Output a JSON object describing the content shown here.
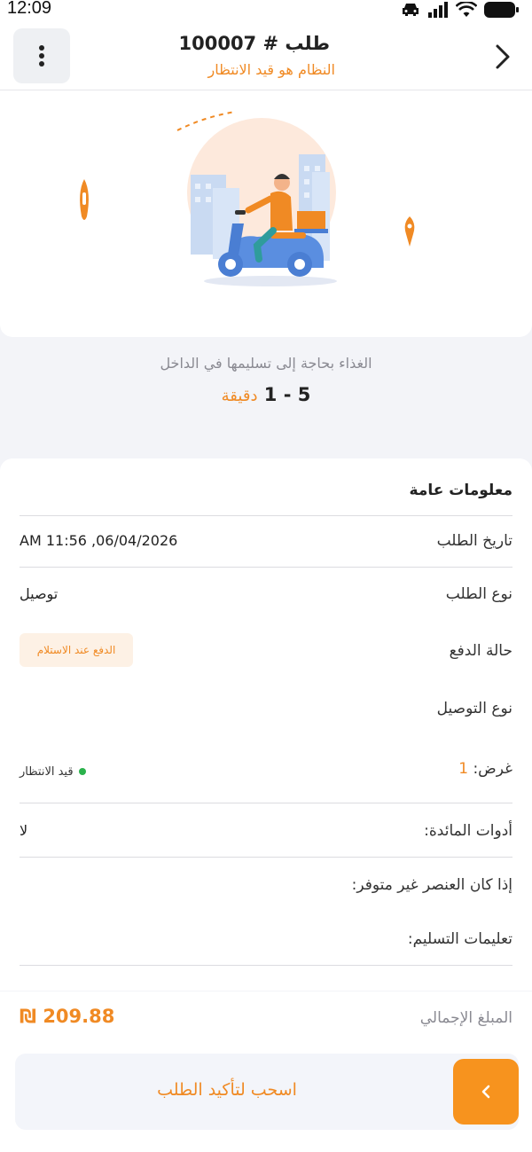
{
  "status_bar": {
    "time": "12:09"
  },
  "header": {
    "order_word": "طلب",
    "order_hash": "#",
    "order_number": "100007",
    "subtitle": "النظام هو قيد الانتظار"
  },
  "eta": {
    "text": "الغذاء بحاجة إلى تسليمها في الداخل",
    "range": "1 - 5",
    "unit": "دقيقة"
  },
  "general_info": {
    "title": "معلومات عامة",
    "order_date_label": "تاريخ الطلب",
    "order_date_value": "AM 11:56 ,06/04/2026",
    "order_type_label": "نوع الطلب",
    "order_type_value": "توصيل",
    "payment_status_label": "حالة الدفع",
    "payment_status_badge": "الدفع عند الاستلام",
    "delivery_type_label": "نوع التوصيل",
    "purpose_label": "غرض:",
    "purpose_value": "1",
    "purpose_status": "قيد الانتظار",
    "cutlery_label": "أدوات المائدة:",
    "cutlery_value": "لا",
    "unavailable_label": "إذا كان العنصر غير متوفر:",
    "delivery_instructions_label": "تعليمات التسليم:"
  },
  "footer": {
    "total_label": "المبلغ الإجمالي",
    "total_value": "209.88 ₪",
    "slide_label": "اسحب لتأكيد الطلب"
  },
  "colors": {
    "accent": "#f08a24",
    "status_green": "#2bb24c",
    "background": "#f3f4f8"
  },
  "icons": {
    "menu": "vertical-dots-icon",
    "back": "chevron-right-icon",
    "slider": "chevron-left-icon",
    "location": "location-pin-icon"
  }
}
